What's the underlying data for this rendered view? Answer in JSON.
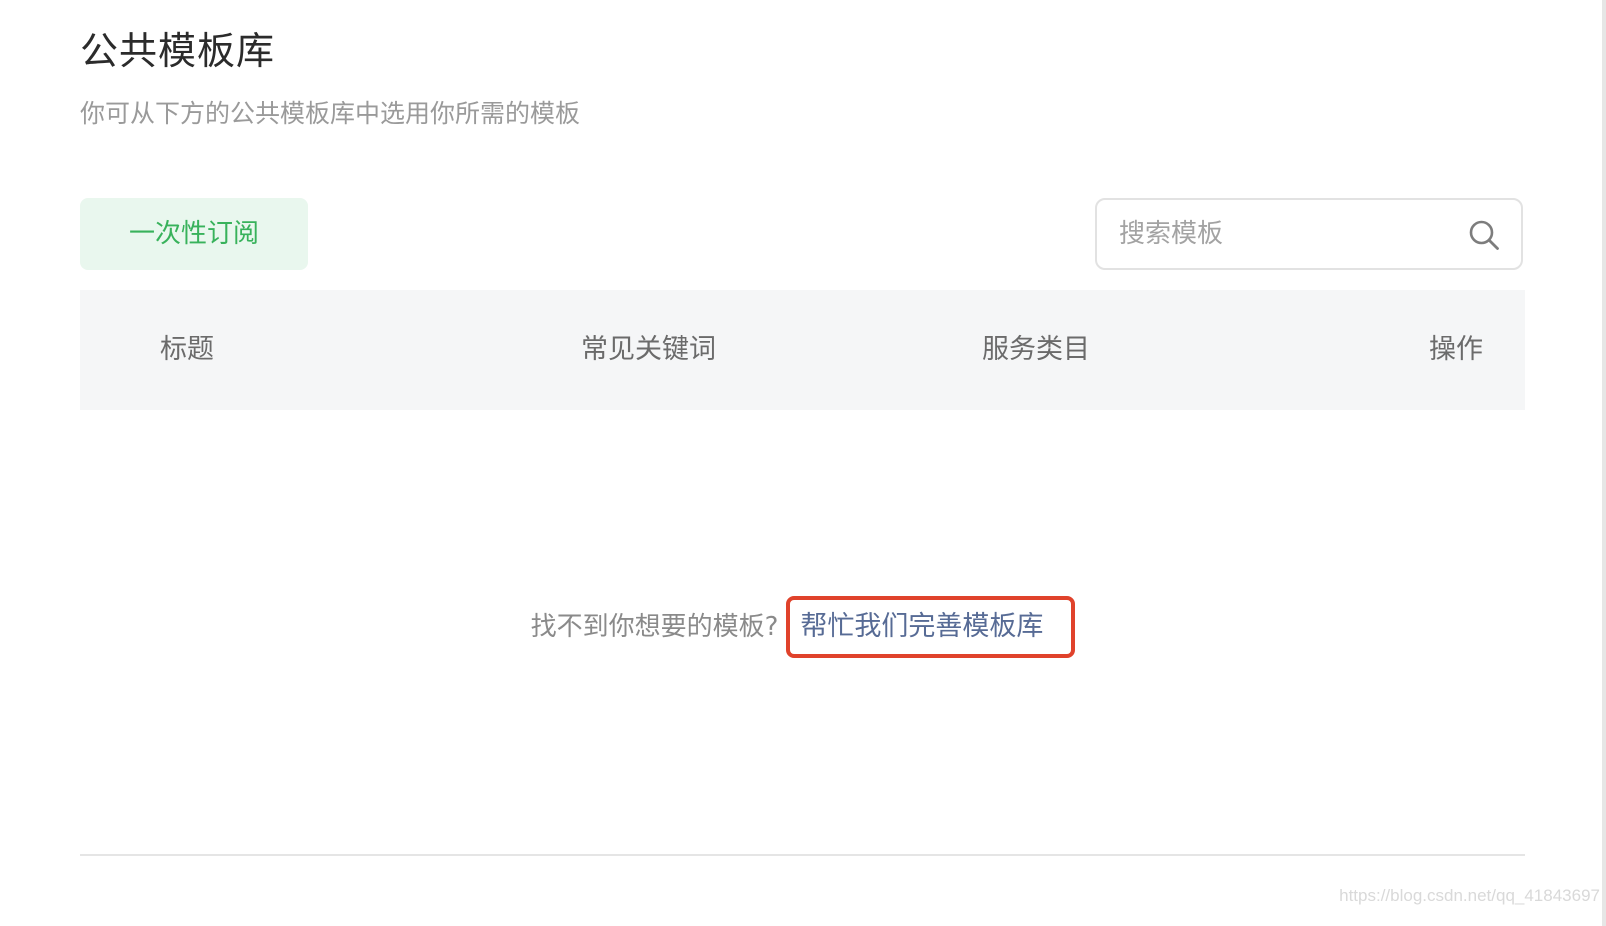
{
  "header": {
    "title": "公共模板库",
    "description": "你可从下方的公共模板库中选用你所需的模板"
  },
  "toolbar": {
    "tab_label": "一次性订阅",
    "search_placeholder": "搜索模板",
    "search_icon": "search-icon"
  },
  "table": {
    "columns": [
      "标题",
      "常见关键词",
      "服务类目",
      "操作"
    ],
    "rows": []
  },
  "empty_state": {
    "message": "找不到你想要的模板?",
    "link_label": "帮忙我们完善模板库"
  },
  "watermark": "https://blog.csdn.net/qq_41843697",
  "colors": {
    "accent_green": "#38b25b",
    "tab_background": "#e9f7ee",
    "link_blue": "#576b95",
    "highlight_red": "#e0422b",
    "header_background": "#f5f6f7"
  }
}
